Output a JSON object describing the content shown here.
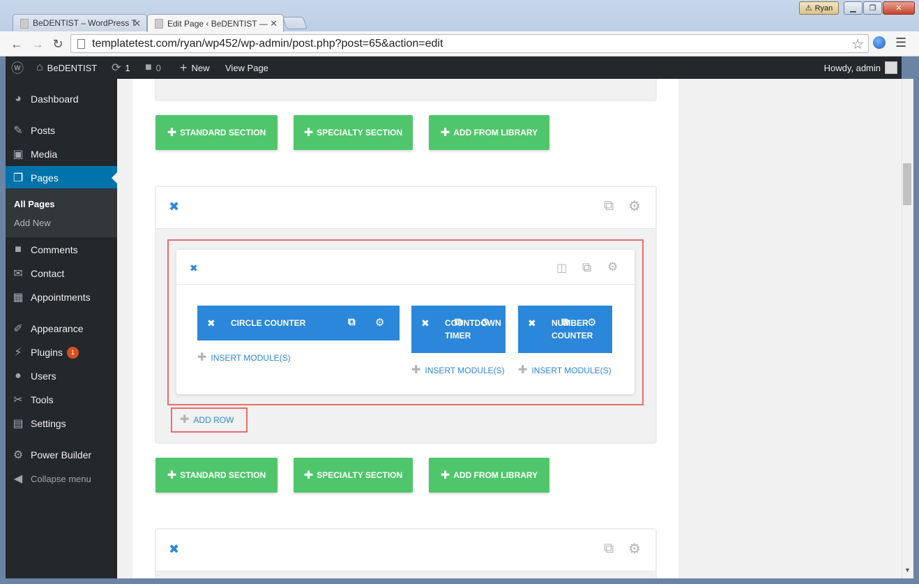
{
  "browser": {
    "user": "Ryan",
    "tabs": [
      {
        "title": "BeDENTIST – WordPress T"
      },
      {
        "title": "Edit Page ‹ BeDENTIST —"
      }
    ],
    "url": "templatetest.com/ryan/wp452/wp-admin/post.php?post=65&action=edit"
  },
  "adminbar": {
    "site_name": "BeDENTIST",
    "updates": "1",
    "comments": "0",
    "new_label": "New",
    "view_page": "View Page",
    "howdy": "Howdy, admin"
  },
  "sidebar": {
    "items": [
      {
        "label": "Dashboard"
      },
      {
        "label": "Posts"
      },
      {
        "label": "Media"
      },
      {
        "label": "Pages"
      },
      {
        "label": "Comments"
      },
      {
        "label": "Contact"
      },
      {
        "label": "Appointments"
      },
      {
        "label": "Appearance"
      },
      {
        "label": "Plugins",
        "badge": "1"
      },
      {
        "label": "Users"
      },
      {
        "label": "Tools"
      },
      {
        "label": "Settings"
      },
      {
        "label": "Power Builder"
      }
    ],
    "pages_submenu": [
      "All Pages",
      "Add New"
    ],
    "collapse": "Collapse menu"
  },
  "builder": {
    "buttons": [
      "STANDARD SECTION",
      "SPECIALTY SECTION",
      "ADD FROM LIBRARY"
    ],
    "modules": [
      {
        "label": "CIRCLE COUNTER"
      },
      {
        "label": "COUNTDOWN TIMER"
      },
      {
        "label": "NUMBER COUNTER"
      }
    ],
    "insert_label": "INSERT MODULE(S)",
    "add_row_label": "ADD ROW"
  },
  "colors": {
    "green_button": "#4fc66b",
    "module_blue": "#2b87da",
    "highlight": "#e86d6d",
    "admin_dark": "#23282d",
    "current_menu": "#0073aa"
  }
}
